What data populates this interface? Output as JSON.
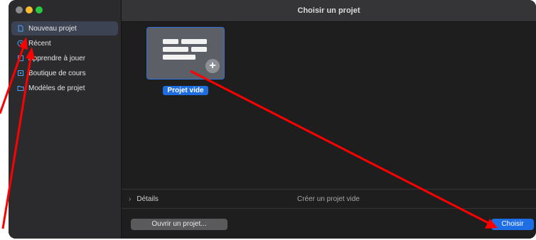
{
  "window": {
    "title": "Choisir un projet"
  },
  "sidebar": {
    "items": [
      {
        "label": "Nouveau projet",
        "icon": "new-document-icon",
        "selected": true
      },
      {
        "label": "Récent",
        "icon": "recent-icon",
        "selected": false
      },
      {
        "label": "Apprendre à jouer",
        "icon": "learn-icon",
        "selected": false
      },
      {
        "label": "Boutique de cours",
        "icon": "store-icon",
        "selected": false
      },
      {
        "label": "Modèles de projet",
        "icon": "folder-icon",
        "selected": false
      }
    ]
  },
  "main": {
    "template": {
      "label": "Projet vide",
      "icon": "empty-project-icon"
    },
    "details": {
      "label": "Détails",
      "description": "Créer un projet vide"
    },
    "footer": {
      "open_label": "Ouvrir un projet...",
      "choose_label": "Choisir"
    }
  },
  "colors": {
    "accent": "#1f6ee0",
    "annotation": "#ff0000"
  }
}
